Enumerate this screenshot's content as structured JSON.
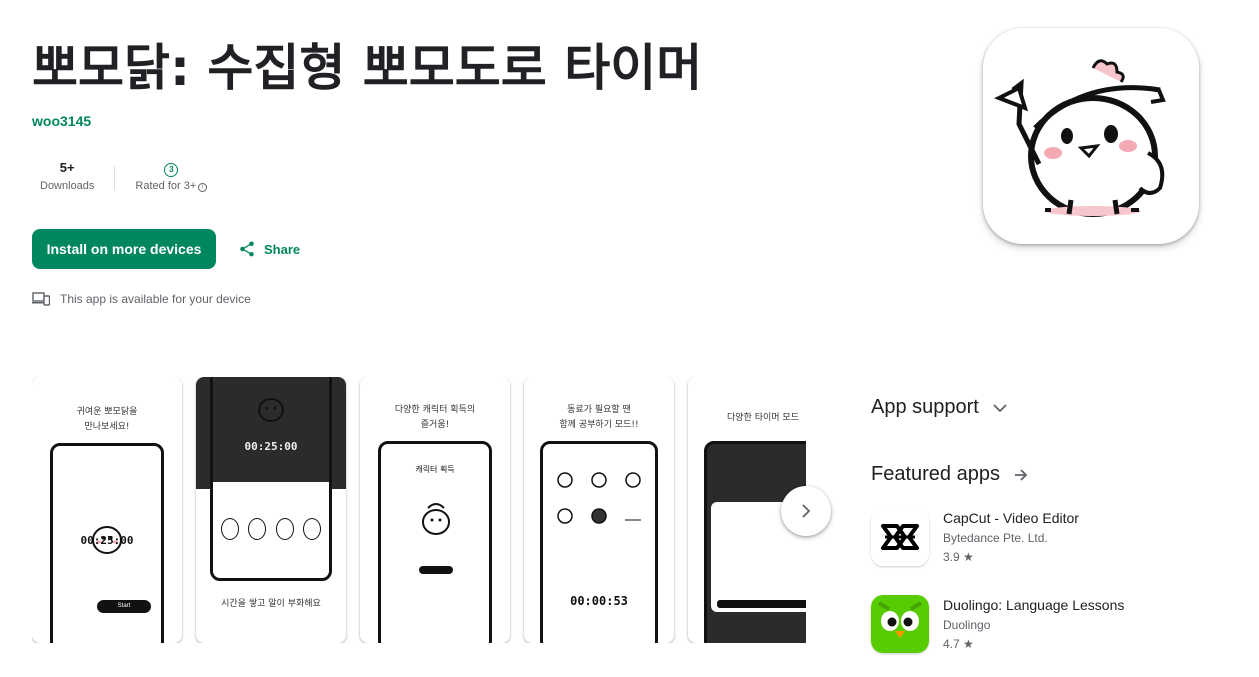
{
  "app": {
    "title": "뽀모닭: 수집형 뽀모도로 타이머",
    "developer": "woo3145"
  },
  "stats": {
    "downloads_value": "5+",
    "downloads_label": "Downloads",
    "rating_badge": "3",
    "rating_label": "Rated for 3+",
    "info_symbol": "i"
  },
  "actions": {
    "install_label": "Install on more devices",
    "share_label": "Share"
  },
  "availability": "This app is available for your device",
  "screenshots": [
    {
      "caption": [
        "귀여운 뽀모닭을",
        "만나보세요!"
      ],
      "timer": "00:25:00",
      "button": "Start"
    },
    {
      "timer": "00:25:00",
      "caption_bottom": "시간을 쌓고 알이 부화해요"
    },
    {
      "caption": [
        "다양한 캐릭터 획득의",
        "즐거움!"
      ],
      "panel_title": "캐릭터 획득"
    },
    {
      "caption": [
        "동료가 필요할 땐",
        "함께 공부하기 모드!!"
      ],
      "timer": "00:00:53"
    },
    {
      "caption": [
        "다양한 타이머 모드"
      ]
    }
  ],
  "sidebar": {
    "app_support_label": "App support",
    "featured_label": "Featured apps",
    "featured": [
      {
        "name": "CapCut - Video Editor",
        "developer": "Bytedance Pte. Ltd.",
        "rating": "3.9 ★",
        "icon": "capcut-icon"
      },
      {
        "name": "Duolingo: Language Lessons",
        "developer": "Duolingo",
        "rating": "4.7 ★",
        "icon": "duolingo-icon"
      }
    ]
  },
  "colors": {
    "accent": "#01875f",
    "text": "#202124",
    "secondary": "#5f6368"
  }
}
